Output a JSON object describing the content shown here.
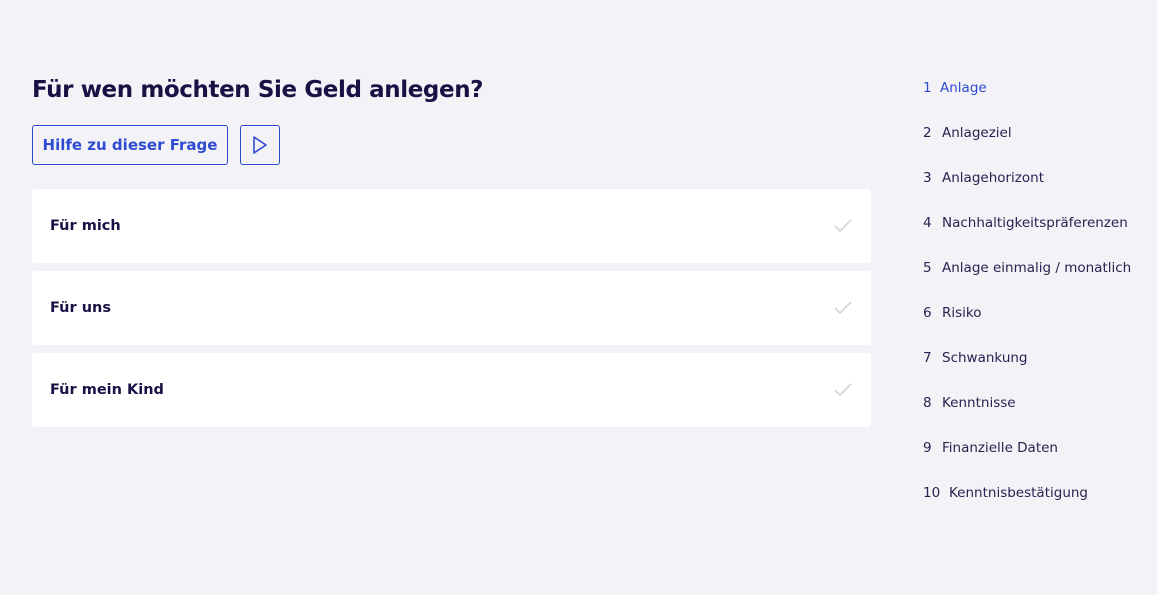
{
  "question": {
    "title": "Für wen möchten Sie Geld anlegen?"
  },
  "actions": {
    "help_label": "Hilfe zu dieser Frage",
    "play_icon": "play-icon"
  },
  "options": [
    {
      "label": "Für mich",
      "icon": "check-icon"
    },
    {
      "label": "Für uns",
      "icon": "check-icon"
    },
    {
      "label": "Für mein Kind",
      "icon": "check-icon"
    }
  ],
  "steps": [
    {
      "num": "1",
      "label": "Anlage",
      "active": true
    },
    {
      "num": "2",
      "label": "Anlageziel"
    },
    {
      "num": "3",
      "label": "Anlagehorizont"
    },
    {
      "num": "4",
      "label": "Nachhaltigkeitspräferenzen"
    },
    {
      "num": "5",
      "label": "Anlage einmalig / monatlich"
    },
    {
      "num": "6",
      "label": "Risiko"
    },
    {
      "num": "7",
      "label": "Schwankung"
    },
    {
      "num": "8",
      "label": "Kenntnisse"
    },
    {
      "num": "9",
      "label": "Finanzielle Daten"
    },
    {
      "num": "10",
      "label": "Kenntnisbestätigung"
    }
  ],
  "colors": {
    "background": "#f3f2f7",
    "accent": "#2e4bd1",
    "text": "#1a1044",
    "check": "#d4d3dc"
  }
}
